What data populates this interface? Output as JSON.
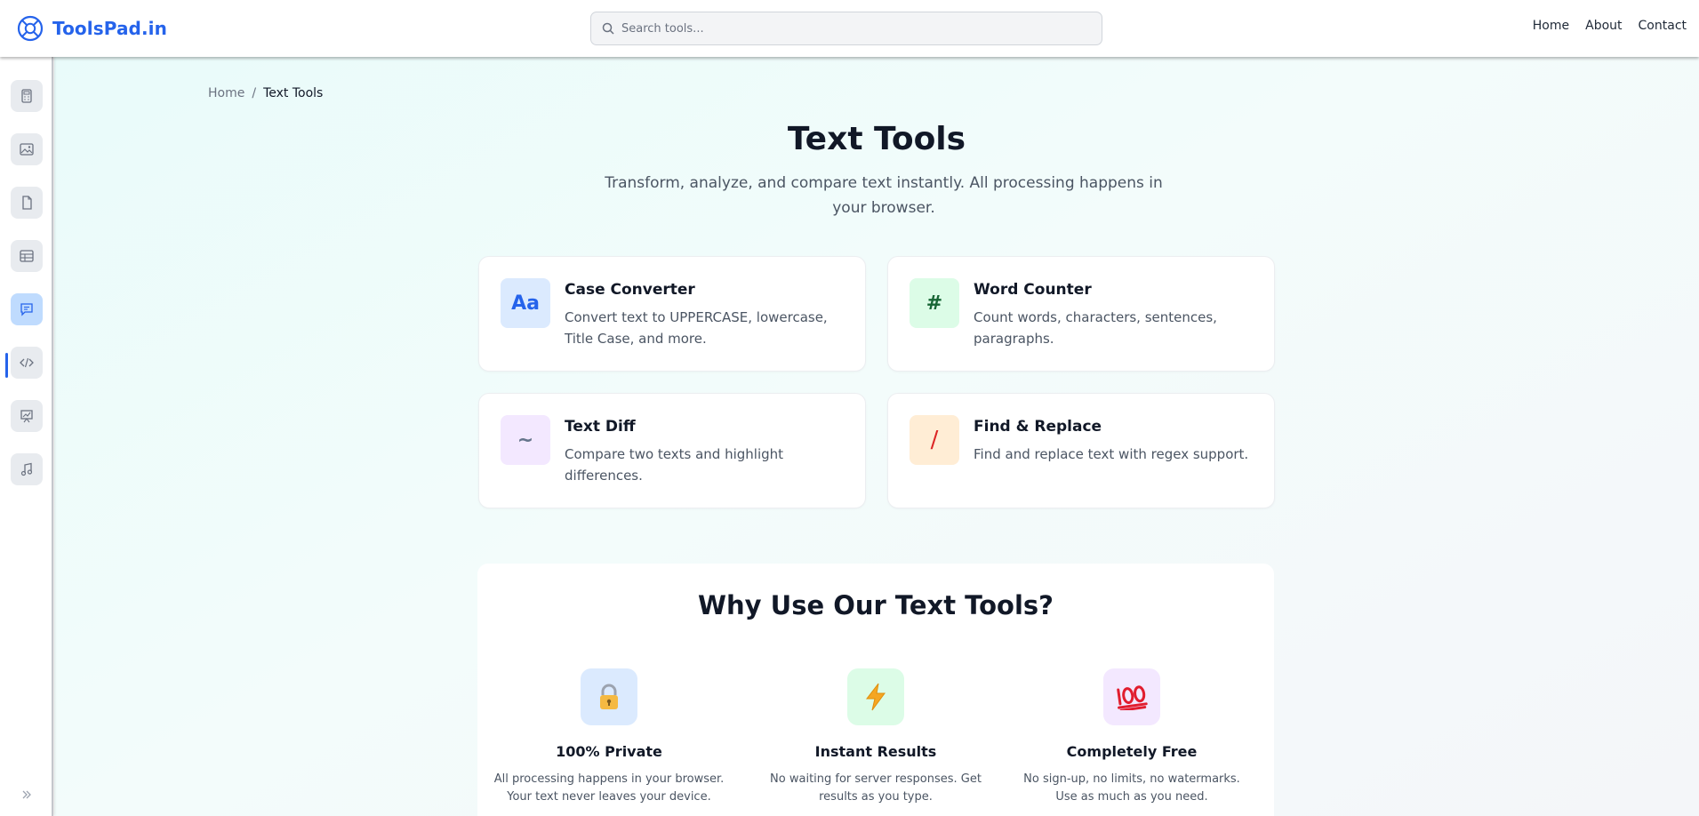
{
  "header": {
    "logo_text": "ToolsPad.in",
    "search_placeholder": "Search tools...",
    "nav": [
      "Home",
      "About",
      "Contact"
    ]
  },
  "sidebar": {
    "items": [
      {
        "icon": "calculator-icon",
        "active": false
      },
      {
        "icon": "image-icon",
        "active": false
      },
      {
        "icon": "document-icon",
        "active": false
      },
      {
        "icon": "table-icon",
        "active": false
      },
      {
        "icon": "chat-text-icon",
        "active": true
      },
      {
        "icon": "code-icon",
        "active": false
      },
      {
        "icon": "chart-board-icon",
        "active": false
      },
      {
        "icon": "music-note-icon",
        "active": false
      }
    ],
    "expand_icon": "double-chevron-right-icon"
  },
  "breadcrumb": {
    "home": "Home",
    "separator": "/",
    "current": "Text Tools"
  },
  "page": {
    "title": "Text Tools",
    "subtitle": "Transform, analyze, and compare text instantly. All processing happens in your browser."
  },
  "tools": [
    {
      "icon_text": "Aa",
      "title": "Case Converter",
      "description": "Convert text to UPPERCASE, lowercase, Title Case, and more.",
      "icon_bg": "#dbeafe",
      "icon_color": "#2563eb"
    },
    {
      "icon_text": "#",
      "title": "Word Counter",
      "description": "Count words, characters, sentences, paragraphs.",
      "icon_bg": "#dcfce7",
      "icon_color": "#166534"
    },
    {
      "icon_text": "~",
      "title": "Text Diff",
      "description": "Compare two texts and highlight differences.",
      "icon_bg": "#f3e8ff",
      "icon_color": "#64748b"
    },
    {
      "icon_text": "/",
      "title": "Find & Replace",
      "description": "Find and replace text with regex support.",
      "icon_bg": "#ffedd5",
      "icon_color": "#dc2626"
    }
  ],
  "why": {
    "title": "Why Use Our Text Tools?",
    "features": [
      {
        "icon": "lock-icon",
        "title": "100% Private",
        "description": "All processing happens in your browser. Your text never leaves your device.",
        "icon_bg": "#dbeafe"
      },
      {
        "icon": "lightning-icon",
        "title": "Instant Results",
        "description": "No waiting for server responses. Get results as you type.",
        "icon_bg": "#dcfce7"
      },
      {
        "icon": "hundred-points-icon",
        "title": "Completely Free",
        "description": "No sign-up, no limits, no watermarks. Use as much as you need.",
        "icon_bg": "#f3e8ff"
      }
    ]
  },
  "colors": {
    "brand": "#2563eb",
    "active_sidebar": "#bfdbfe"
  }
}
